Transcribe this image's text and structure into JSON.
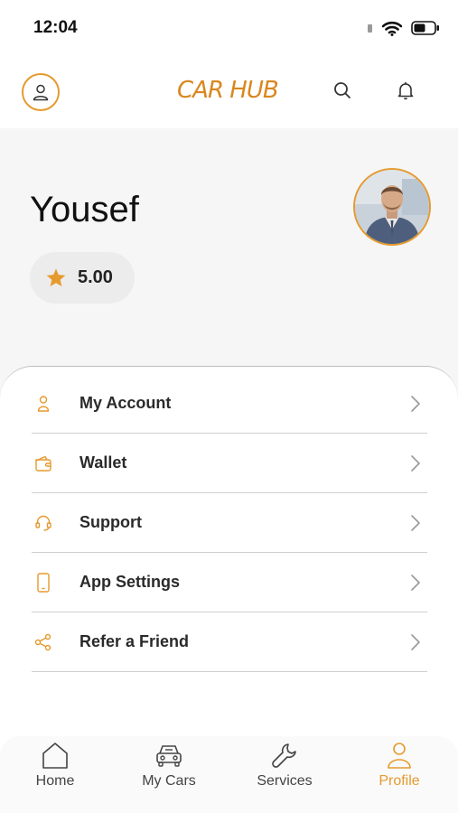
{
  "status_bar": {
    "time": "12:04"
  },
  "header": {
    "logo_text": "CAR HUB"
  },
  "profile": {
    "name": "Yousef",
    "rating": "5.00"
  },
  "menu": [
    {
      "label": "My Account",
      "icon": "user-icon"
    },
    {
      "label": "Wallet",
      "icon": "wallet-icon"
    },
    {
      "label": "Support",
      "icon": "headset-icon"
    },
    {
      "label": "App Settings",
      "icon": "phone-icon"
    },
    {
      "label": "Refer a Friend",
      "icon": "share-icon"
    }
  ],
  "tabs": [
    {
      "label": "Home",
      "icon": "home-icon",
      "active": false
    },
    {
      "label": "My Cars",
      "icon": "car-icon",
      "active": false
    },
    {
      "label": "Services",
      "icon": "wrench-icon",
      "active": false
    },
    {
      "label": "Profile",
      "icon": "user-icon",
      "active": true
    }
  ],
  "colors": {
    "accent": "#E69A2E",
    "logo": "#D9871F",
    "hero_bg": "#F6F6F6"
  }
}
